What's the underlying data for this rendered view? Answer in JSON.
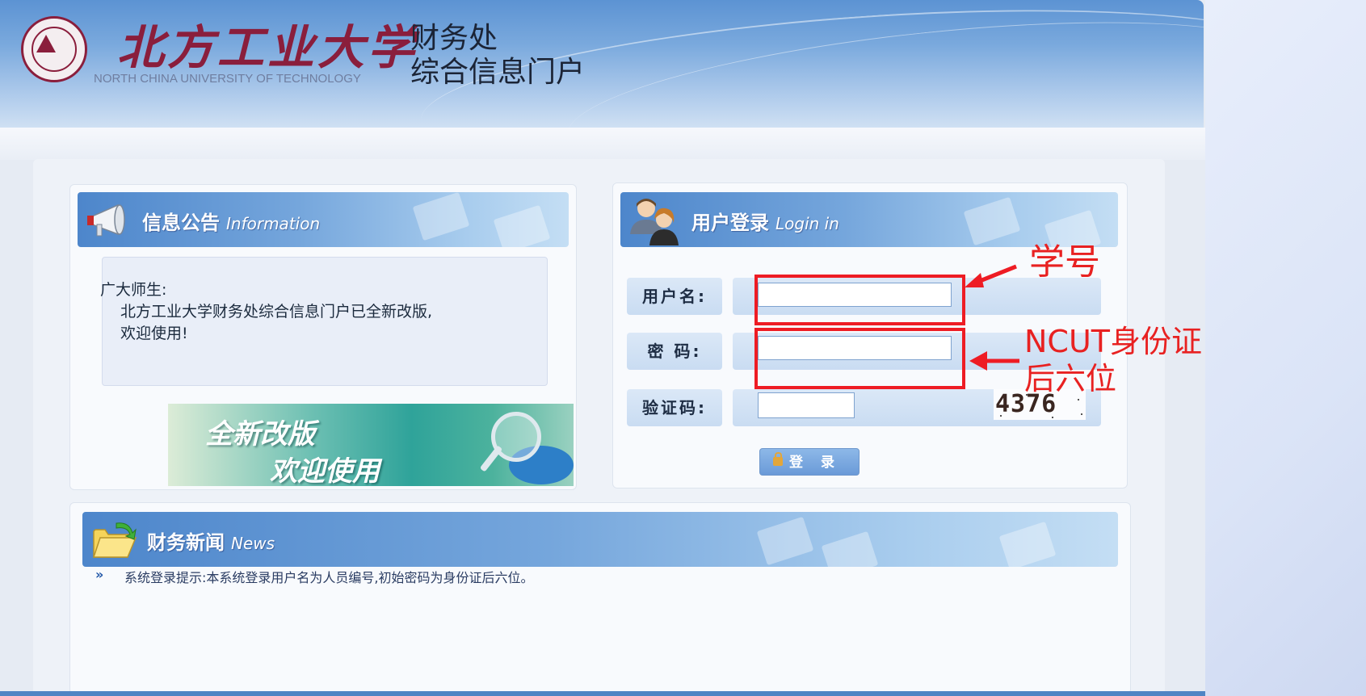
{
  "header": {
    "university_cn": "北方工业大学",
    "university_en": "NORTH CHINA UNIVERSITY OF TECHNOLOGY",
    "portal_line1": "财务处",
    "portal_line2": "综合信息门户"
  },
  "info_panel": {
    "title": "信息公告",
    "title_en": "Information",
    "greeting": "广大师生:",
    "message_line1": "北方工业大学财务处综合信息门户已全新改版,",
    "message_line2": "欢迎使用!",
    "banner_line1": "全新改版",
    "banner_line2": "欢迎使用"
  },
  "login_panel": {
    "title": "用户登录",
    "title_en": "Login in",
    "username_label": "用户名:",
    "password_label": "密  码:",
    "captcha_label": "验证码:",
    "username_value": "",
    "password_value": "",
    "captcha_value": "",
    "captcha_image_text": "4376",
    "login_button": "登 录"
  },
  "annotations": {
    "username_note": "学号",
    "password_note_line1": "NCUT身份证",
    "password_note_line2": "后六位",
    "color": "#ee1c24"
  },
  "news_panel": {
    "title": "财务新闻",
    "title_en": "News",
    "items": [
      {
        "bullet": "»",
        "text": "系统登录提示:本系统登录用户名为人员编号,初始密码为身份证后六位。"
      }
    ]
  },
  "colors": {
    "header_blue": "#5c93d3",
    "brand_maroon": "#8a1e3c",
    "panel_bg": "#f8fafd"
  }
}
